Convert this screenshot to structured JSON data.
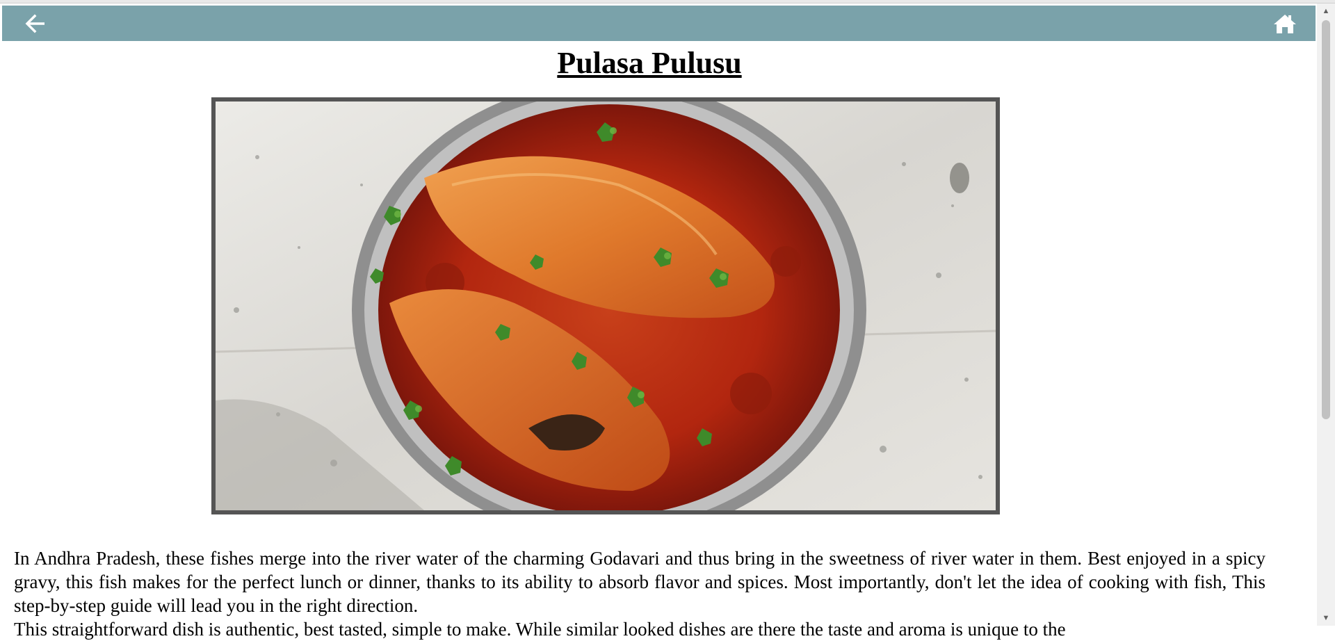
{
  "header": {
    "back_icon": "arrow-left-icon",
    "home_icon": "home-icon",
    "background": "#7aa2aa"
  },
  "recipe": {
    "title": "Pulasa Pulusu",
    "image_alt": "Pulasa fish curry in a steel bowl",
    "paragraph_1": "In Andhra Pradesh, these fishes merge into the river water of the charming Godavari and thus bring in the sweetness of river water in them. Best enjoyed in a spicy gravy, this fish makes for the perfect lunch or dinner, thanks to its ability to absorb flavor and spices. Most importantly, don't let the idea of cooking with fish, This step-by-step guide will lead you in the right direction.",
    "paragraph_2": "This straightforward dish is authentic, best tasted, simple to make. While similar looked dishes are there the taste and aroma is unique to the"
  }
}
